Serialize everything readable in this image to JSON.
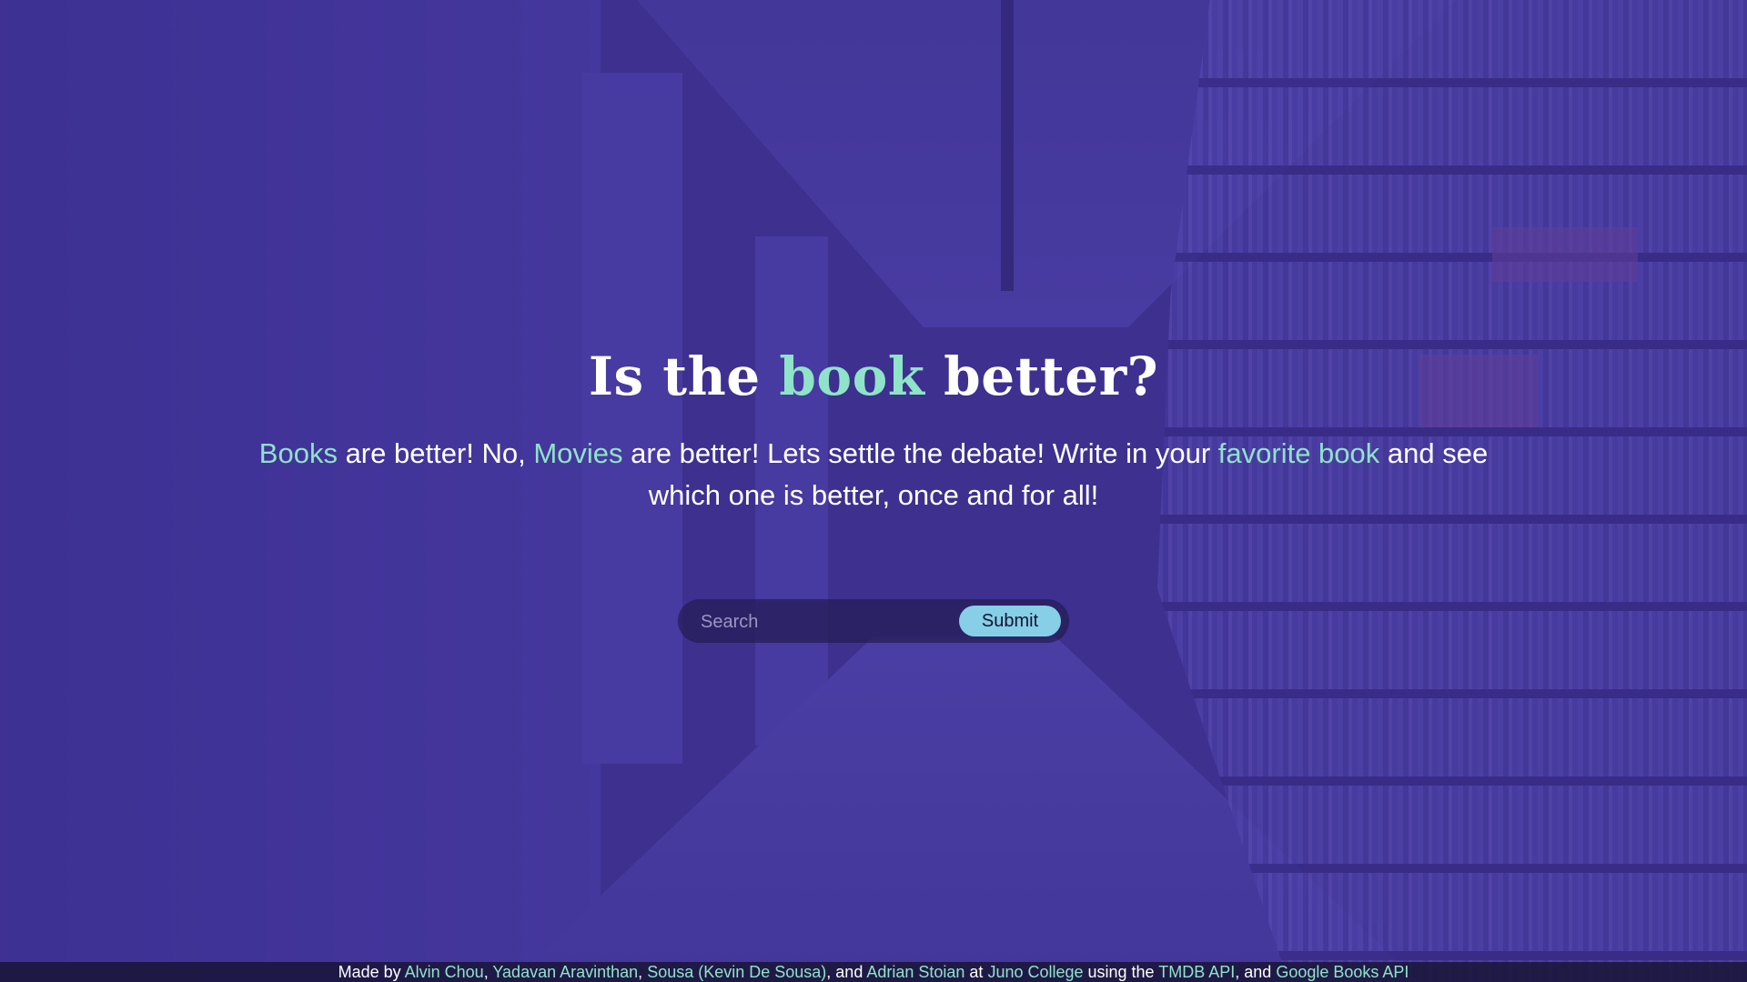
{
  "hero": {
    "title_before": "Is the ",
    "title_accent": "book",
    "title_after": " better?",
    "sub_books": "Books",
    "sub_text1": " are better! No, ",
    "sub_movies": "Movies",
    "sub_text2": " are better! Lets settle the debate! Write in your ",
    "sub_favorite": "favorite book",
    "sub_text3": " and see which one is better, once and for all!"
  },
  "search": {
    "placeholder": "Search",
    "submit_label": "Submit"
  },
  "footer": {
    "made_by": "Made by ",
    "author1": "Alvin Chou",
    "sep1": ", ",
    "author2": "Yadavan Aravinthan",
    "sep2": ", ",
    "author3": "Sousa (Kevin De Sousa)",
    "sep3": ", and ",
    "author4": "Adrian Stoian",
    "at": " at ",
    "school": "Juno College",
    "using": " using the ",
    "api1": "TMDB API",
    "and": ", and ",
    "api2": "Google Books API"
  },
  "colors": {
    "accent": "#8fe3c8",
    "overlay": "#3e3296",
    "submit_bg": "#86cfe6"
  }
}
